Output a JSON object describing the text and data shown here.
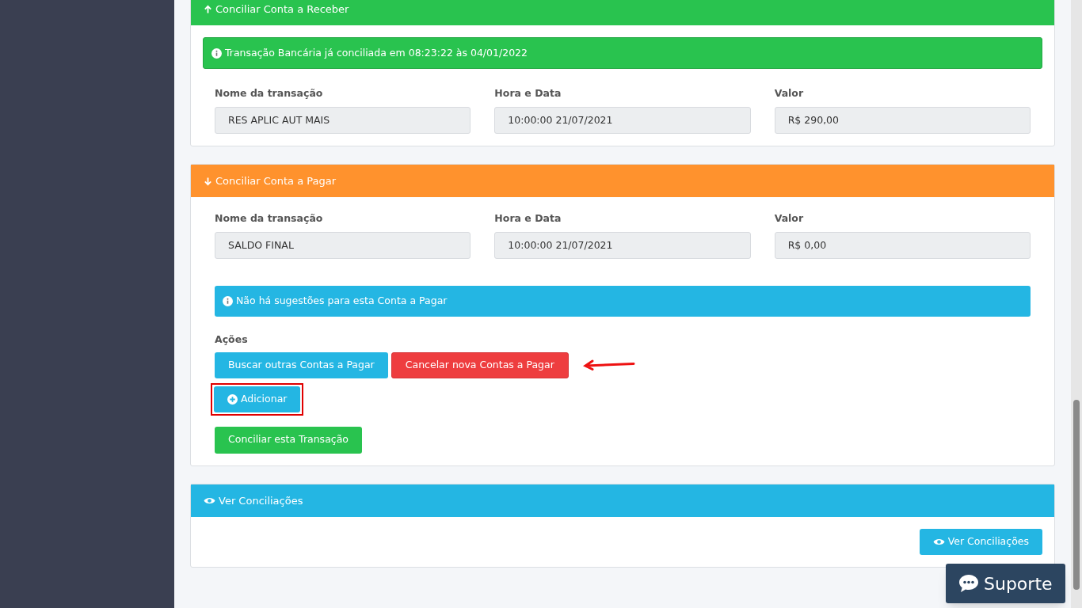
{
  "receber": {
    "title": "Conciliar Conta a Receber",
    "notice": "Transação Bancária já conciliada em 08:23:22 às 04/01/2022",
    "fields": [
      {
        "label": "Nome da transação",
        "value": "RES APLIC AUT MAIS"
      },
      {
        "label": "Hora e Data",
        "value": "10:00:00 21/07/2021"
      },
      {
        "label": "Valor",
        "value": "R$ 290,00"
      }
    ]
  },
  "pagar": {
    "title": "Conciliar Conta a Pagar",
    "fields": [
      {
        "label": "Nome da transação",
        "value": "SALDO FINAL"
      },
      {
        "label": "Hora e Data",
        "value": "10:00:00 21/07/2021"
      },
      {
        "label": "Valor",
        "value": "R$ 0,00"
      }
    ],
    "notice": "Não há sugestões para esta Conta a Pagar",
    "actions_label": "Ações",
    "actions": [
      {
        "label": "Buscar outras Contas a Pagar",
        "kind": "info"
      },
      {
        "label": "Cancelar nova Contas a Pagar",
        "kind": "danger"
      }
    ],
    "add_button": "Adicionar",
    "confirm_button": "Conciliar esta Transação"
  },
  "ver": {
    "title": "Ver Conciliações",
    "button": "Ver Conciliações"
  },
  "support_button": "Suporte"
}
